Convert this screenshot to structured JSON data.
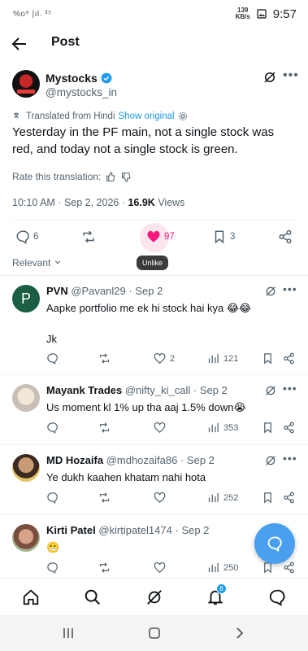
{
  "status_bar": {
    "left_indicators": "%o⁹ |ıl. ³⁵",
    "speed_top": "139",
    "speed_bottom": "KB/s",
    "time": "9:57"
  },
  "header": {
    "title": "Post"
  },
  "post": {
    "author_name": "Mystocks",
    "author_handle": "@mystocks_in",
    "translated_label": "Translated from Hindi",
    "show_original": "Show original",
    "text": "Yesterday in the PF main, not a single stock was red, and today not a single stock is green.",
    "rate_label": "Rate this translation:",
    "time": "10:10 AM",
    "date": "Sep 2, 2026",
    "views_count": "16.9K",
    "views_label": "Views",
    "replies": "6",
    "likes": "97",
    "bookmarks": "3",
    "tooltip": "Unlike",
    "sort_label": "Relevant"
  },
  "replies": [
    {
      "name": "PVN",
      "handle": "@Pavanl29",
      "date": "Sep 2",
      "text": "Aapke portfolio me ek hi stock hai kya 😂😂",
      "text2": "Jk",
      "likes": "2",
      "views": "121",
      "avatar_letter": "P"
    },
    {
      "name": "Mayank Trades",
      "handle": "@nifty_ki_call",
      "date": "Sep 2",
      "text": "Us moment kl 1% up tha aaj 1.5% down😭",
      "likes": "",
      "views": "353"
    },
    {
      "name": "MD Hozaifa",
      "handle": "@mdhozaifa86",
      "date": "Sep 2",
      "text": "Ye dukh kaahen khatam nahi hota",
      "likes": "",
      "views": "252"
    },
    {
      "name": "Kirti Patel",
      "handle": "@kirtipatel1474",
      "date": "Sep 2",
      "text": "😬",
      "likes": "",
      "views": "250"
    }
  ],
  "nav": {
    "notifications_badge": "8"
  },
  "colors": {
    "accent": "#1d9bf0",
    "like": "#f91880",
    "verified": "#1d9bf0"
  }
}
